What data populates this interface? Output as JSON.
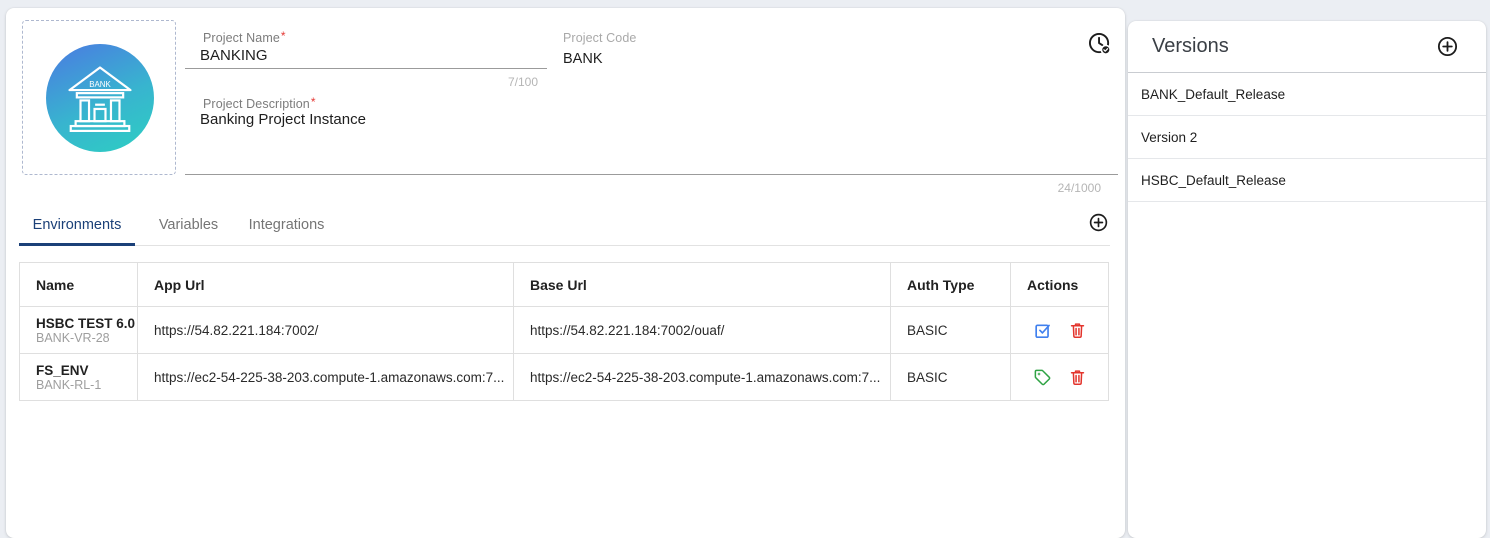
{
  "project": {
    "icon_text": "BANK",
    "required_marker": "*",
    "name_label": "Project Name",
    "name_value": "BANKING",
    "name_counter": "7/100",
    "code_label": "Project Code",
    "code_value": "BANK",
    "desc_label": "Project Description",
    "desc_value": "Banking Project Instance",
    "desc_counter": "24/1000"
  },
  "tabs": [
    {
      "label": "Environments",
      "active": true
    },
    {
      "label": "Variables",
      "active": false
    },
    {
      "label": "Integrations",
      "active": false
    }
  ],
  "table": {
    "columns": [
      "Name",
      "App Url",
      "Base Url",
      "Auth Type",
      "Actions"
    ],
    "rows": [
      {
        "name": "HSBC TEST 6.0",
        "code": "BANK-VR-28",
        "app_url": "https://54.82.221.184:7002/",
        "base_url": "https://54.82.221.184:7002/ouaf/",
        "auth_type": "BASIC",
        "action_icons": [
          "select-check",
          "delete"
        ]
      },
      {
        "name": "FS_ENV",
        "code": "BANK-RL-1",
        "app_url": "https://ec2-54-225-38-203.compute-1.amazonaws.com:7...",
        "base_url": "https://ec2-54-225-38-203.compute-1.amazonaws.com:7...",
        "auth_type": "BASIC",
        "action_icons": [
          "tag",
          "delete"
        ]
      }
    ]
  },
  "versions": {
    "title": "Versions",
    "items": [
      "BANK_Default_Release",
      "Version 2",
      "HSBC_Default_Release"
    ]
  },
  "colors": {
    "accent_navy": "#1b4078",
    "icon_blue": "#4080ee",
    "icon_green": "#2fa344",
    "icon_red": "#e3342c",
    "required_red": "#e53935"
  }
}
